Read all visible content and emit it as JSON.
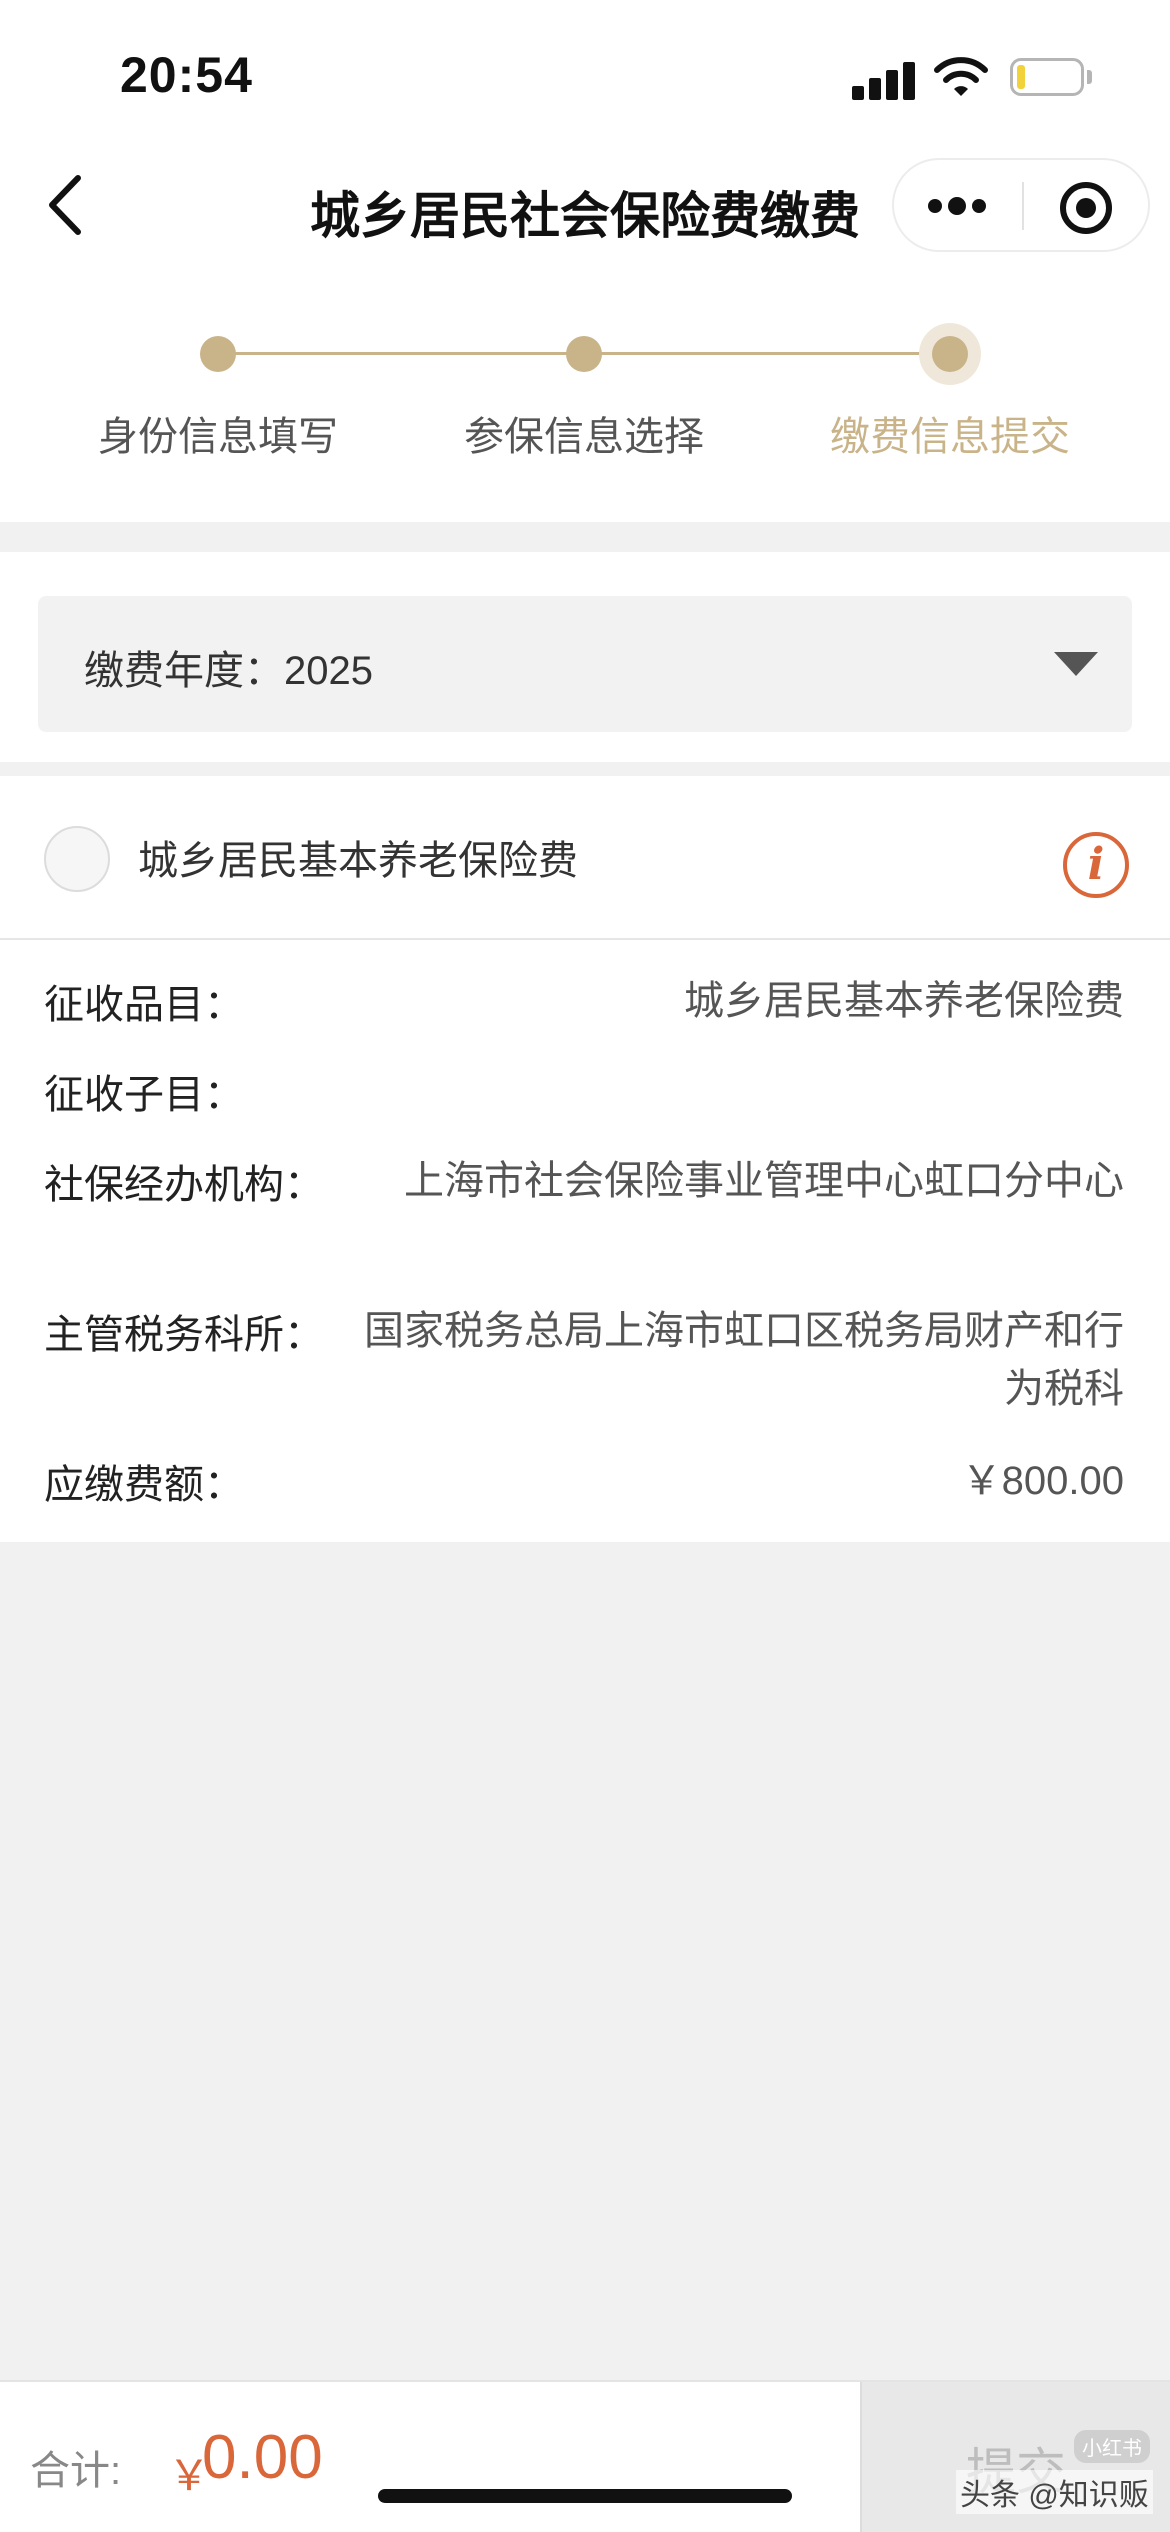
{
  "status_bar": {
    "time": "20:54"
  },
  "nav": {
    "title": "城乡居民社会保险费缴费"
  },
  "steps": [
    {
      "label": "身份信息填写",
      "state": "done"
    },
    {
      "label": "参保信息选择",
      "state": "done"
    },
    {
      "label": "缴费信息提交",
      "state": "active"
    }
  ],
  "year_select": {
    "label": "缴费年度：",
    "value": "2025"
  },
  "item": {
    "title": "城乡居民基本养老保险费",
    "details": [
      {
        "label": "征收品目：",
        "value": "城乡居民基本养老保险费"
      },
      {
        "label": "征收子目：",
        "value": ""
      },
      {
        "label": "社保经办机构：",
        "value": "上海市社会保险事业管理中心虹口分中心"
      },
      {
        "label": "主管税务科所：",
        "value": "国家税务总局上海市虹口区税务局财产和行为税科"
      },
      {
        "label": "应缴费额：",
        "value": "￥800.00"
      }
    ]
  },
  "bottom": {
    "total_label": "合计:",
    "currency": "￥",
    "total_value": "0.00",
    "submit_label": "提交",
    "badge": "小红书"
  },
  "watermark": "头条 @知识贩",
  "colors": {
    "accent_gold": "#c9b48a",
    "accent_orange": "#d9673a"
  }
}
